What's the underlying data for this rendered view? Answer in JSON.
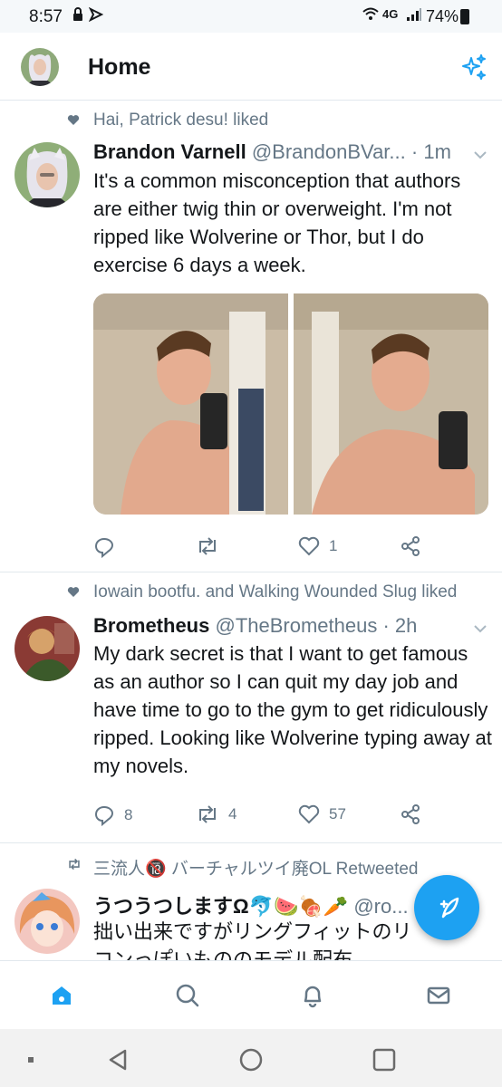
{
  "status_bar": {
    "time": "8:57",
    "network": "4G",
    "battery_percent": "74%"
  },
  "header": {
    "title": "Home",
    "avatar_icon": "user-avatar",
    "sparkle_icon": "sparkle-icon"
  },
  "tweets": [
    {
      "social_context": "Hai, Patrick desu! liked",
      "social_icon": "heart-icon",
      "name": "Brandon Varnell",
      "handle": "@BrandonBVar...",
      "time": "· 1m",
      "text": "It's a common misconception that authors are either twig thin or overweight. I'm not ripped like Wolverine or Thor, but I do exercise 6 days a week.",
      "media_count": 2,
      "replies": "",
      "retweets": "",
      "likes": "1"
    },
    {
      "social_context": "Iowain bootfu. and Walking Wounded Slug liked",
      "social_icon": "heart-icon",
      "name": "Brometheus",
      "handle": "@TheBrometheus",
      "time": "· 2h",
      "text": "My dark secret is that I want to get famous as an author so I can quit my day job and have time to go to the gym to get ridiculously ripped. Looking like Wolverine typing away at my novels.",
      "replies": "8",
      "retweets": "4",
      "likes": "57"
    },
    {
      "social_context": "三流人🔞 バーチャルツイ廃OL Retweeted",
      "social_icon": "retweet-icon",
      "name": "うつうつしますΩ🐬🍉🍖🥕",
      "handle": "@ro...",
      "text_line1": "拙い出来ですがリングフィットのリ",
      "text_line2": "コンっぽいもののモデル配布"
    }
  ],
  "nav": {
    "items": [
      "home",
      "search",
      "notifications",
      "messages"
    ]
  },
  "colors": {
    "accent": "#1da1f2",
    "secondary_text": "#657786",
    "divider": "#e1e8ed"
  }
}
